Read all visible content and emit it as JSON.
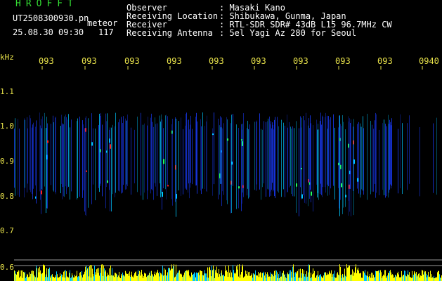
{
  "header": {
    "title": "HROFFT",
    "file_name": "UT2508300930.pn",
    "mode": "meteor",
    "datetime": "25.08.30 09:30",
    "count": "117",
    "observer_label": "Observer",
    "observer_value": ": Masaki Kano",
    "location_label": "Receiving Location",
    "location_value": ": Shibukawa, Gunma, Japan",
    "receiver_label": "Receiver",
    "receiver_value": ": RTL-SDR SDR# 43dB L15 96.7MHz CW",
    "antenna_label": "Receiving Antenna",
    "antenna_value": ": 5el Yagi Az 280 for Seoul"
  },
  "axis": {
    "unit": "kHz",
    "time_ticks": [
      "093",
      "093",
      "093",
      "093",
      "093",
      "093",
      "093",
      "093",
      "093",
      "0940"
    ],
    "freq_ticks": [
      "1.1",
      "1.0",
      "0.9",
      "0.8",
      "0.7",
      "0.6"
    ]
  },
  "colors": {
    "background": "#000000",
    "header_green": "#33dd33",
    "header_white": "#ffffff",
    "axis_yellow": "#e8e24a",
    "signal_blue": "#1a3cff",
    "signal_cyan": "#00c8ff",
    "signal_green": "#20ff60",
    "signal_red": "#ff2020",
    "strip_yellow": "#ffff00"
  }
}
